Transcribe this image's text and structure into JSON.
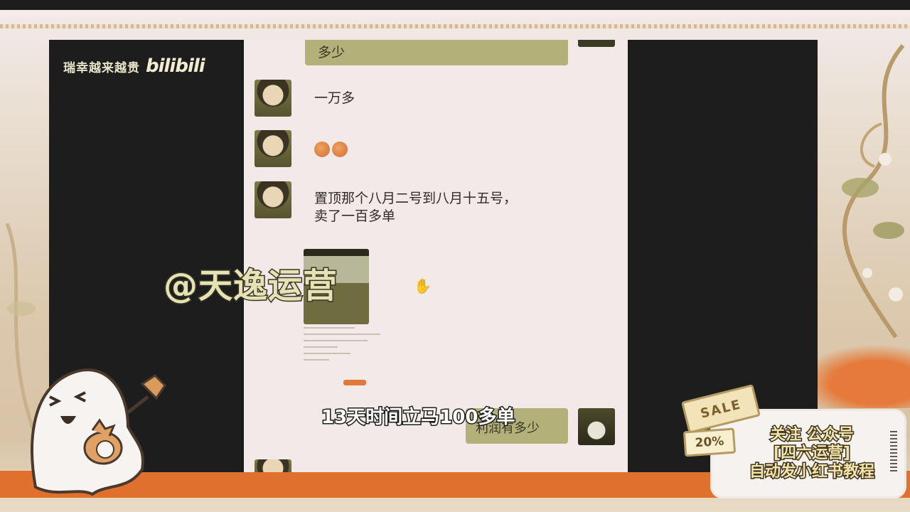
{
  "channel": {
    "name": "瑞幸越来越贵",
    "platform_logo": "bilibili"
  },
  "chat": {
    "top_bubble": "多少",
    "messages": [
      {
        "side": "left",
        "text": "一万多"
      },
      {
        "side": "left",
        "text": "🍑🍑",
        "emoji": "peach-emoji"
      },
      {
        "side": "left",
        "line1": "置顶那个八月二号到八月十五号，",
        "line2": "卖了一百多单"
      }
    ],
    "right_bubble": "利润有多少"
  },
  "overlay": {
    "watermark": "@天逸运营",
    "subtitle": "13天时间立马100多单"
  },
  "promo": {
    "sale_tag": "SALE",
    "discount": "20%",
    "lines": [
      "关注 公众号",
      "[四六运营]",
      "自动发小红书教程"
    ]
  },
  "colors": {
    "accent_orange": "#e0702e",
    "bubble_olive": "#b4b07a",
    "video_bg": "#1e1d1d"
  }
}
